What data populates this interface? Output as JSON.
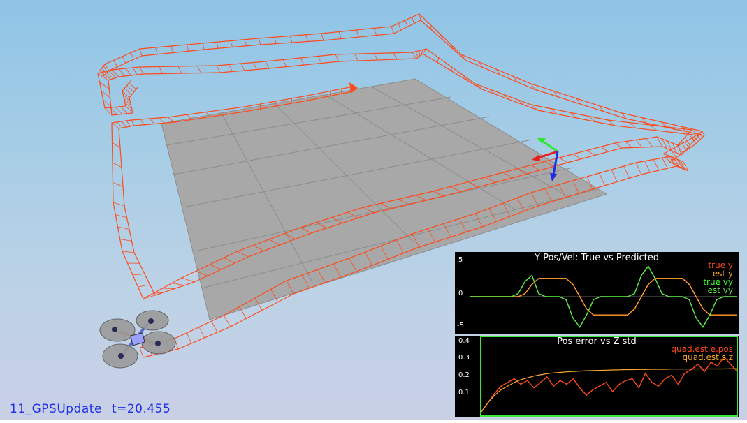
{
  "status": {
    "scenario": "11_GPSUpdate",
    "time": "t=20.455"
  },
  "colors": {
    "trajectory": "#ff4a1a",
    "ground": "#a6a6a6",
    "true_y": "#ff4a1a",
    "est_y": "#ffab2b",
    "true_vy": "#39ff30",
    "est_vy": "#63e04a",
    "pos_err": "#ff4a1a",
    "z_std": "#ffab2b",
    "plot_border": "#3ae83a",
    "status_text": "#1f2fe8"
  },
  "plot1": {
    "title": "Y Pos/Vel: True vs Predicted",
    "yticks": [
      "5",
      "0",
      "-5"
    ],
    "legend": [
      "true y",
      "est y",
      "true vy",
      "est vy"
    ]
  },
  "plot2": {
    "title": "Pos error vs Z std",
    "yticks": [
      "0.4",
      "0.3",
      "0.2",
      "0.1"
    ],
    "legend": [
      "quad.est.e.pos",
      "quad.est.s.z"
    ]
  },
  "chart_data": [
    {
      "type": "line",
      "title": "Y Pos/Vel: True vs Predicted",
      "ylim": [
        -5.5,
        5.5
      ],
      "yticks": [
        5,
        0,
        -5
      ],
      "series": [
        {
          "name": "true y",
          "values": [
            0,
            0,
            0,
            0,
            0,
            0,
            0,
            0,
            0.5,
            2.0,
            3.0,
            3.0,
            3.0,
            3.0,
            3.0,
            2.0,
            0,
            -2.0,
            -3.0,
            -3.0,
            -3.0,
            -3.0,
            -3.0,
            -3.0,
            -2.0,
            0,
            2.0,
            3.0,
            3.0,
            3.0,
            3.0,
            3.0,
            2.0,
            0,
            -2.0,
            -3.0,
            -3.0,
            -3.0,
            -3.0,
            -3.0
          ]
        },
        {
          "name": "est y",
          "values": [
            0,
            0,
            0,
            0,
            0,
            0,
            0,
            0,
            0.5,
            2.0,
            3.0,
            3.0,
            3.0,
            3.0,
            3.0,
            2.0,
            0,
            -2.0,
            -3.0,
            -3.0,
            -3.0,
            -3.0,
            -3.0,
            -3.0,
            -2.0,
            0,
            2.0,
            3.0,
            3.0,
            3.0,
            3.0,
            3.0,
            2.0,
            0,
            -2.0,
            -3.0,
            -3.0,
            -3.0,
            -3.0,
            -3.0
          ]
        },
        {
          "name": "true vy",
          "values": [
            0,
            0,
            0,
            0,
            0,
            0,
            0,
            0.5,
            2.5,
            3.5,
            0.5,
            0,
            0,
            0,
            -0.5,
            -3.5,
            -5.0,
            -3.0,
            -0.5,
            0,
            0,
            0,
            0,
            0,
            0.5,
            3.5,
            5.0,
            3.0,
            0.5,
            0,
            0,
            0,
            -0.5,
            -3.5,
            -5.0,
            -3.0,
            -0.5,
            0,
            0,
            0
          ]
        },
        {
          "name": "est vy",
          "values": [
            0,
            0,
            0,
            0,
            0,
            0,
            0,
            0.5,
            2.5,
            3.5,
            0.5,
            0,
            0,
            0,
            -0.5,
            -3.5,
            -5.0,
            -3.0,
            -0.5,
            0,
            0,
            0,
            0,
            0,
            0.5,
            3.5,
            5.0,
            3.0,
            0.5,
            0,
            0,
            0,
            -0.5,
            -3.5,
            -5.0,
            -3.0,
            -0.5,
            0,
            0,
            0
          ]
        }
      ]
    },
    {
      "type": "line",
      "title": "Pos error vs Z std",
      "ylim": [
        0,
        0.42
      ],
      "yticks": [
        0.1,
        0.2,
        0.3,
        0.4
      ],
      "series": [
        {
          "name": "quad.est.e.pos",
          "values": [
            0.02,
            0.07,
            0.12,
            0.16,
            0.18,
            0.2,
            0.17,
            0.19,
            0.15,
            0.18,
            0.21,
            0.16,
            0.19,
            0.17,
            0.2,
            0.15,
            0.11,
            0.14,
            0.16,
            0.18,
            0.13,
            0.17,
            0.19,
            0.2,
            0.15,
            0.23,
            0.18,
            0.16,
            0.2,
            0.22,
            0.17,
            0.23,
            0.25,
            0.28,
            0.24,
            0.29,
            0.27,
            0.32,
            0.28,
            0.24
          ]
        },
        {
          "name": "quad.est.s.z",
          "values": [
            0.02,
            0.07,
            0.11,
            0.14,
            0.16,
            0.18,
            0.195,
            0.205,
            0.215,
            0.222,
            0.228,
            0.232,
            0.235,
            0.238,
            0.24,
            0.242,
            0.244,
            0.245,
            0.246,
            0.247,
            0.248,
            0.249,
            0.25,
            0.25,
            0.251,
            0.251,
            0.252,
            0.252,
            0.252,
            0.253,
            0.253,
            0.253,
            0.253,
            0.254,
            0.254,
            0.254,
            0.254,
            0.254,
            0.255,
            0.255
          ]
        }
      ]
    }
  ]
}
